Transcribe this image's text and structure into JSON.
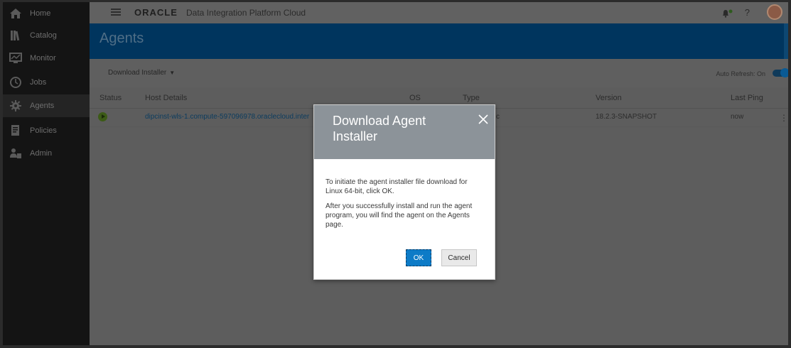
{
  "sidebar": {
    "items": [
      {
        "label": "Home",
        "icon": "home-icon"
      },
      {
        "label": "Catalog",
        "icon": "catalog-icon"
      },
      {
        "label": "Monitor",
        "icon": "monitor-icon"
      },
      {
        "label": "Jobs",
        "icon": "clock-icon"
      },
      {
        "label": "Agents",
        "icon": "gear-icon"
      },
      {
        "label": "Policies",
        "icon": "policies-icon"
      },
      {
        "label": "Admin",
        "icon": "admin-icon"
      }
    ],
    "active": "Agents"
  },
  "header": {
    "brand": "ORACLE",
    "product": "Data Integration Platform Cloud",
    "help": "?"
  },
  "page": {
    "title": "Agents"
  },
  "toolbar": {
    "download_label": "Download Installer",
    "auto_refresh_label": "Auto Refresh: On"
  },
  "table": {
    "columns": [
      "Status",
      "Host Details",
      "OS",
      "Type",
      "Version",
      "Last Ping"
    ],
    "rows": [
      {
        "host": "dipcinst-wls-1.compute-597096978.oraclecloud.inter",
        "type_partial": "c",
        "version": "18.2.3-SNAPSHOT",
        "last_ping": "now"
      }
    ]
  },
  "dialog": {
    "title": "Download Agent Installer",
    "body1": "To initiate the agent installer file download for Linux 64-bit, click OK.",
    "body2": "After you successfully install and run the agent program, you will find the agent on the Agents page.",
    "ok_label": "OK",
    "cancel_label": "Cancel"
  },
  "colors": {
    "banner": "#00355e",
    "ok_button": "#0d7bc7",
    "dialog_header": "#8c9399"
  }
}
